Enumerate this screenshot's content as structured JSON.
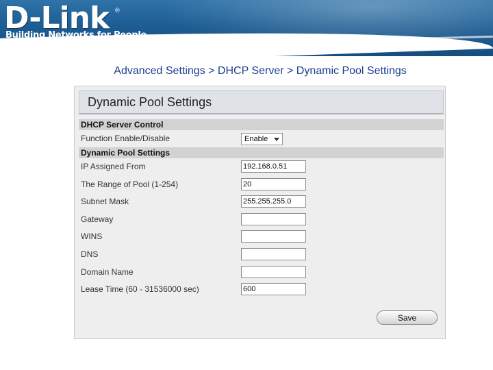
{
  "header": {
    "logo_text": "D-Link",
    "logo_mark": "®",
    "tagline": "Building Networks for People",
    "brand_color": "#1d5d93"
  },
  "breadcrumb": "Advanced Settings > DHCP Server > Dynamic Pool Settings",
  "panel": {
    "title": "Dynamic Pool Settings",
    "sections": {
      "control": {
        "header": "DHCP Server Control",
        "function_label": "Function Enable/Disable",
        "function_value": "Enable"
      },
      "pool": {
        "header": "Dynamic Pool Settings",
        "fields": [
          {
            "label": "IP Assigned From",
            "value": ""
          },
          {
            "label": "The Range of Pool (1-254)",
            "value": "20"
          },
          {
            "label": "Subnet Mask",
            "value": "255.255.255.0"
          },
          {
            "label": "Gateway",
            "value": ""
          },
          {
            "label": "WINS",
            "value": ""
          },
          {
            "label": "DNS",
            "value": ""
          },
          {
            "label": "Domain Name",
            "value": ""
          },
          {
            "label": "Lease Time (60 - 31536000 sec)",
            "value": "600"
          }
        ],
        "ip_assigned_from": "192.168.0.51"
      }
    },
    "save_label": "Save"
  }
}
